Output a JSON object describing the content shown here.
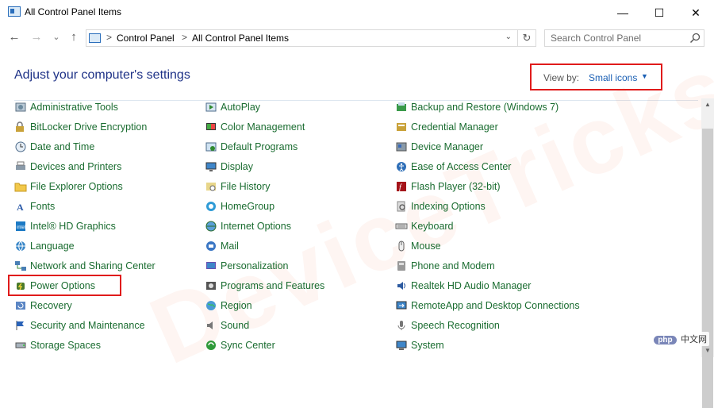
{
  "window": {
    "title": "All Control Panel Items",
    "minimize": "—",
    "maximize": "☐",
    "close": "✕"
  },
  "nav": {
    "back": "←",
    "forward": "→",
    "recent": "⌄",
    "up": "↑"
  },
  "address": {
    "crumbs": [
      "Control Panel",
      "All Control Panel Items"
    ],
    "separator": ">",
    "dropdown": "⌄",
    "refresh": "↻"
  },
  "search": {
    "placeholder": "Search Control Panel"
  },
  "heading": "Adjust your computer's settings",
  "view_by": {
    "label": "View by:",
    "value": "Small icons",
    "arrow": "▼"
  },
  "columns": [
    [
      {
        "label": "Administrative Tools",
        "icon": "administrative-tools-icon"
      },
      {
        "label": "BitLocker Drive Encryption",
        "icon": "bitlocker-icon"
      },
      {
        "label": "Date and Time",
        "icon": "clock-icon"
      },
      {
        "label": "Devices and Printers",
        "icon": "printer-icon"
      },
      {
        "label": "File Explorer Options",
        "icon": "folder-options-icon"
      },
      {
        "label": "Fonts",
        "icon": "fonts-icon"
      },
      {
        "label": "Intel® HD Graphics",
        "icon": "intel-graphics-icon"
      },
      {
        "label": "Language",
        "icon": "language-icon"
      },
      {
        "label": "Network and Sharing Center",
        "icon": "network-icon"
      },
      {
        "label": "Power Options",
        "icon": "power-icon"
      },
      {
        "label": "Recovery",
        "icon": "recovery-icon"
      },
      {
        "label": "Security and Maintenance",
        "icon": "flag-icon"
      },
      {
        "label": "Storage Spaces",
        "icon": "storage-icon"
      }
    ],
    [
      {
        "label": "AutoPlay",
        "icon": "autoplay-icon"
      },
      {
        "label": "Color Management",
        "icon": "color-management-icon"
      },
      {
        "label": "Default Programs",
        "icon": "default-programs-icon"
      },
      {
        "label": "Display",
        "icon": "display-icon"
      },
      {
        "label": "File History",
        "icon": "file-history-icon"
      },
      {
        "label": "HomeGroup",
        "icon": "homegroup-icon"
      },
      {
        "label": "Internet Options",
        "icon": "internet-options-icon"
      },
      {
        "label": "Mail",
        "icon": "mail-icon"
      },
      {
        "label": "Personalization",
        "icon": "personalization-icon"
      },
      {
        "label": "Programs and Features",
        "icon": "programs-icon"
      },
      {
        "label": "Region",
        "icon": "region-icon"
      },
      {
        "label": "Sound",
        "icon": "speaker-icon"
      },
      {
        "label": "Sync Center",
        "icon": "sync-icon"
      }
    ],
    [
      {
        "label": "Backup and Restore (Windows 7)",
        "icon": "backup-icon"
      },
      {
        "label": "Credential Manager",
        "icon": "credential-icon"
      },
      {
        "label": "Device Manager",
        "icon": "device-manager-icon"
      },
      {
        "label": "Ease of Access Center",
        "icon": "ease-of-access-icon"
      },
      {
        "label": "Flash Player (32-bit)",
        "icon": "flash-icon"
      },
      {
        "label": "Indexing Options",
        "icon": "indexing-icon"
      },
      {
        "label": "Keyboard",
        "icon": "keyboard-icon"
      },
      {
        "label": "Mouse",
        "icon": "mouse-icon"
      },
      {
        "label": "Phone and Modem",
        "icon": "phone-icon"
      },
      {
        "label": "Realtek HD Audio Manager",
        "icon": "realtek-icon"
      },
      {
        "label": "RemoteApp and Desktop Connections",
        "icon": "remoteapp-icon"
      },
      {
        "label": "Speech Recognition",
        "icon": "microphone-icon"
      },
      {
        "label": "System",
        "icon": "system-icon"
      }
    ]
  ],
  "watermark": "DeviceTricks",
  "badge": {
    "logo": "php",
    "site": "中文网"
  },
  "scrollbar": {
    "up": "▲",
    "down": "▼"
  },
  "colors": {
    "link": "#1a6c30",
    "heading": "#1e3287",
    "highlight": "#e01b1b",
    "view_value": "#1a5fb4"
  }
}
